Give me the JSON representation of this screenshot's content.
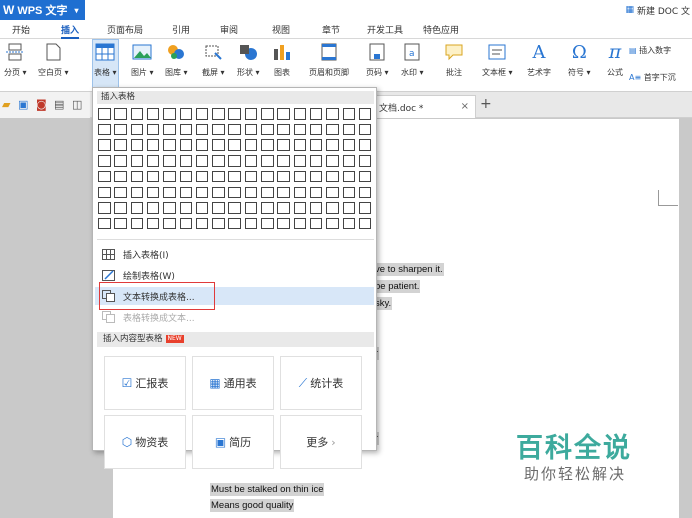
{
  "app": {
    "title": "WPS 文字",
    "doc_title": "新建 DOC 文"
  },
  "menu_tabs": [
    "开始",
    "插入",
    "页面布局",
    "引用",
    "审阅",
    "视图",
    "章节",
    "开发工具",
    "特色应用"
  ],
  "active_tab": "插入",
  "ribbon": {
    "buttons": [
      {
        "label": "分页",
        "icon": "page-break-icon"
      },
      {
        "label": "空白页",
        "icon": "blank-page-icon"
      },
      {
        "label": "表格",
        "icon": "table-icon",
        "selected": true
      },
      {
        "label": "图片",
        "icon": "picture-icon"
      },
      {
        "label": "图库",
        "icon": "gallery-icon"
      },
      {
        "label": "截屏",
        "icon": "screenshot-icon"
      },
      {
        "label": "形状",
        "icon": "shapes-icon"
      },
      {
        "label": "图表",
        "icon": "chart-icon"
      },
      {
        "label": "页眉和页脚",
        "icon": "header-footer-icon"
      },
      {
        "label": "页码",
        "icon": "page-number-icon"
      },
      {
        "label": "水印",
        "icon": "watermark-icon"
      },
      {
        "label": "批注",
        "icon": "comment-icon"
      },
      {
        "label": "文本框",
        "icon": "textbox-icon"
      },
      {
        "label": "艺术字",
        "icon": "wordart-icon"
      },
      {
        "label": "符号",
        "icon": "symbol-icon"
      },
      {
        "label": "公式",
        "icon": "formula-icon"
      }
    ],
    "insert_digits": "插入数字",
    "first_char_down": "首字下沉"
  },
  "doc_tab": {
    "name": "文档.doc *",
    "close": "×",
    "new_tab": "+"
  },
  "table_dropdown": {
    "header": "插入表格",
    "grid_rows": 8,
    "grid_cols": 17,
    "menu": [
      {
        "label": "插入表格(I)",
        "icon": "insert-table-icon",
        "enabled": true
      },
      {
        "label": "绘制表格(W)",
        "icon": "draw-table-icon",
        "enabled": true
      },
      {
        "label": "文本转换成表格...",
        "icon": "text-to-table-icon",
        "enabled": true,
        "highlighted": true
      },
      {
        "label": "表格转换成文本...",
        "icon": "table-to-text-icon",
        "enabled": false
      }
    ],
    "content_table_header": "插入内容型表格",
    "new_badge": "NEW",
    "cards": [
      {
        "label": "汇报表",
        "icon": "report-icon"
      },
      {
        "label": "通用表",
        "icon": "grid-icon"
      },
      {
        "label": "统计表",
        "icon": "stats-chart-icon"
      },
      {
        "label": "物资表",
        "icon": "box-icon"
      },
      {
        "label": "简历",
        "icon": "resume-icon"
      },
      {
        "label": "更多",
        "icon": "chevron-right-icon"
      }
    ]
  },
  "document_lines": [
    "ve to sharpen it.",
    "be patient.",
    "sky.",
    "r",
    "r",
    "Must be stalked on thin ice",
    "Means good quality"
  ],
  "watermark": {
    "title": "百科全说",
    "subtitle": "助你轻松解决"
  },
  "colors": {
    "wps_blue": "#1f6fd1",
    "active_tab": "#1a5fbf",
    "highlight": "#d8e7f8",
    "red_box": "#e03a3a",
    "watermark": "#3daa9d"
  }
}
